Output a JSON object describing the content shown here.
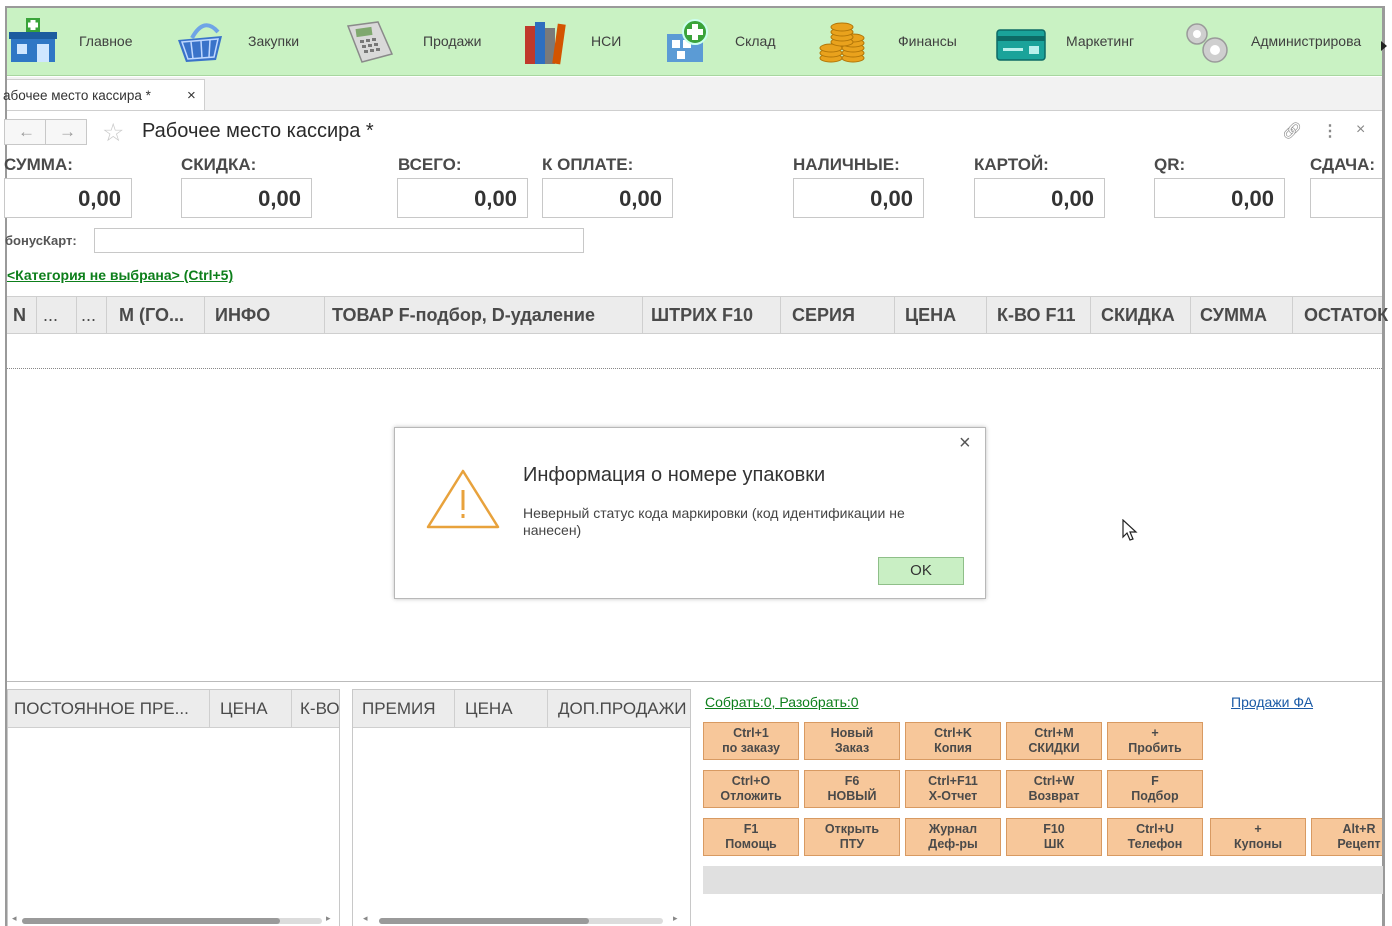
{
  "sections": [
    {
      "label": "Главное",
      "icon": "pharmacy-icon"
    },
    {
      "label": "Закупки",
      "icon": "basket-icon"
    },
    {
      "label": "Продажи",
      "icon": "cash-register-icon"
    },
    {
      "label": "НСИ",
      "icon": "books-icon"
    },
    {
      "label": "Склад",
      "icon": "warehouse-icon"
    },
    {
      "label": "Финансы",
      "icon": "coins-icon"
    },
    {
      "label": "Маркетинг",
      "icon": "card-icon"
    },
    {
      "label": "Администрирова",
      "icon": "gears-icon"
    }
  ],
  "tab": {
    "label": "абочее место кассира *",
    "close": "×"
  },
  "page": {
    "title": "Рабочее место кассира *"
  },
  "totals": [
    {
      "label": "СУММА:",
      "value": "0,00"
    },
    {
      "label": "СКИДКА:",
      "value": "0,00"
    },
    {
      "label": "ВСЕГО:",
      "value": "0,00"
    },
    {
      "label": "К ОПЛАТЕ:",
      "value": "0,00"
    },
    {
      "label": "НАЛИЧНЫЕ:",
      "value": "0,00"
    },
    {
      "label": "КАРТОЙ:",
      "value": "0,00"
    },
    {
      "label": "QR:",
      "value": "0,00"
    },
    {
      "label": "СДАЧА:",
      "value": ""
    }
  ],
  "bonus": {
    "label": "бонусКарт:",
    "value": ""
  },
  "category_link": "<Категория не выбрана> (Ctrl+5)",
  "grid": {
    "columns": [
      "N",
      "...",
      "...",
      "М (ГО...",
      "ИНФО",
      "ТОВАР  F-подбор, D-удаление",
      "ШТРИХ F10",
      "СЕРИЯ",
      "ЦЕНА",
      "К-ВО F11",
      "СКИДКА",
      "СУММА",
      "ОСТАТОК"
    ]
  },
  "dialog": {
    "title": "Информация о номере упаковки",
    "message": "Неверный статус кода маркировки (код идентификации не нанесен)",
    "ok": "OK",
    "close": "×"
  },
  "left_grid": {
    "columns": [
      "ПОСТОЯННОЕ ПРЕ...",
      "ЦЕНА",
      "К-ВО"
    ]
  },
  "mid_grid": {
    "columns": [
      "ПРЕМИЯ",
      "ЦЕНА",
      "ДОП.ПРОДАЖИ"
    ]
  },
  "collect_link": "Собрать:0, Разобрать:0",
  "sales_link": "Продажи ФА",
  "action_buttons": [
    {
      "key": "Ctrl+1",
      "label": "по заказу"
    },
    {
      "key": "Новый",
      "label": "Заказ"
    },
    {
      "key": "Ctrl+K",
      "label": "Копия"
    },
    {
      "key": "Ctrl+M",
      "label": "СКИДКИ"
    },
    {
      "key": "+",
      "label": "Пробить"
    },
    {
      "key": "Ctrl+O",
      "label": "Отложить"
    },
    {
      "key": "F6",
      "label": "НОВЫЙ"
    },
    {
      "key": "Ctrl+F11",
      "label": "X-Отчет"
    },
    {
      "key": "Ctrl+W",
      "label": "Возврат"
    },
    {
      "key": "F",
      "label": "Подбор"
    },
    {
      "key": "F1",
      "label": "Помощь"
    },
    {
      "key": "Открыть",
      "label": "ПТУ"
    },
    {
      "key": "Журнал",
      "label": "Деф-ры"
    },
    {
      "key": "F10",
      "label": "ШК"
    },
    {
      "key": "Ctrl+U",
      "label": "Телефон"
    },
    {
      "key": "+",
      "label": "Купоны"
    },
    {
      "key": "Alt+R",
      "label": "Рецепт"
    }
  ],
  "colors": {
    "section_bar": "#c9f2c3",
    "action_button": "#f7c79a",
    "link_green": "#0d7f1b",
    "link_blue": "#1a5aa6",
    "warning": "#e8a23c"
  }
}
